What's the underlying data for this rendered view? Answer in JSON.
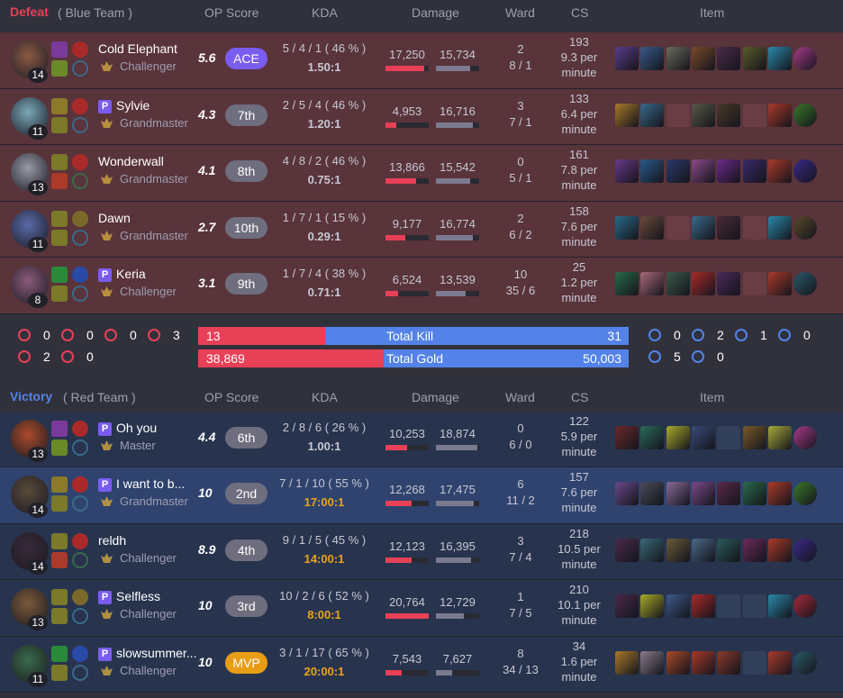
{
  "columns": {
    "op_score": "OP Score",
    "kda": "KDA",
    "damage": "Damage",
    "ward": "Ward",
    "cs": "CS",
    "item": "Item"
  },
  "teams": [
    {
      "result": "Defeat",
      "name": "( Blue Team )",
      "result_color": "#e84057",
      "players": [
        {
          "name": "Cold Elephant",
          "tier": "Challenger",
          "level": "14",
          "score": "5.6",
          "badge": "ACE",
          "kda": "5 / 4 / 1  ( 46 % )",
          "ratio": "1.50:1",
          "dmg_dealt": "17,250",
          "dmg_taken": "15,734",
          "dmg_dealt_fill": 0.9,
          "dmg_taken_fill": 0.8,
          "ward_top": "2",
          "ward_bottom": "8 / 1",
          "cs": "193",
          "cs_rate": "9.3 per",
          "cs_unit": "minute",
          "champ_color": "#8a5a44",
          "items": [
            "#5a3d8a",
            "#3a5a8a",
            "#6a6a5a",
            "#7a4a2a",
            "#4a2a4a",
            "#5a5a2a",
            "#2a8aaa",
            "#aa3a8a"
          ]
        },
        {
          "name": "Sylvie",
          "tier": "Grandmaster",
          "level": "11",
          "score": "4.3",
          "badge": "7th",
          "kda": "2 / 5 / 4  ( 46 % )",
          "ratio": "1.20:1",
          "dmg_dealt": "4,953",
          "dmg_taken": "16,716",
          "dmg_dealt_fill": 0.25,
          "dmg_taken_fill": 0.85,
          "ward_top": "3",
          "ward_bottom": "7 / 1",
          "cs": "133",
          "cs_rate": "6.4 per",
          "cs_unit": "minute",
          "champ_color": "#7aa8b8",
          "items": [
            "#a87a2a",
            "#3a6a8a",
            "",
            "#5a5a4a",
            "#4a3a2a",
            "",
            "#aa3a2a",
            "#3a7a2a"
          ]
        },
        {
          "name": "Wonderwall",
          "tier": "Grandmaster",
          "level": "13",
          "score": "4.1",
          "badge": "8th",
          "kda": "4 / 8 / 2  ( 46 % )",
          "ratio": "0.75:1",
          "dmg_dealt": "13,866",
          "dmg_taken": "15,542",
          "dmg_dealt_fill": 0.7,
          "dmg_taken_fill": 0.8,
          "ward_top": "0",
          "ward_bottom": "5 / 1",
          "cs": "161",
          "cs_rate": "7.8 per",
          "cs_unit": "minute",
          "champ_color": "#9a9aa8",
          "items": [
            "#6a3a8a",
            "#2a5a8a",
            "#2a3a6a",
            "#8a4a8a",
            "#6a2a8a",
            "#3a2a6a",
            "#aa3a2a",
            "#3a2a8a"
          ]
        },
        {
          "name": "Dawn",
          "tier": "Grandmaster",
          "level": "11",
          "score": "2.7",
          "badge": "10th",
          "kda": "1 / 7 / 1  ( 15 % )",
          "ratio": "0.29:1",
          "dmg_dealt": "9,177",
          "dmg_taken": "16,774",
          "dmg_dealt_fill": 0.45,
          "dmg_taken_fill": 0.85,
          "ward_top": "2",
          "ward_bottom": "6 / 2",
          "cs": "158",
          "cs_rate": "7.6 per",
          "cs_unit": "minute",
          "champ_color": "#5a6aa8",
          "items": [
            "#2a6a8a",
            "#6a4a3a",
            "",
            "#3a6a8a",
            "#4a2a3a",
            "",
            "#2a8aaa",
            "#5a4a2a"
          ]
        },
        {
          "name": "Keria",
          "tier": "Challenger",
          "level": "8",
          "score": "3.1",
          "badge": "9th",
          "kda": "1 / 7 / 4  ( 38 % )",
          "ratio": "0.71:1",
          "dmg_dealt": "6,524",
          "dmg_taken": "13,539",
          "dmg_dealt_fill": 0.3,
          "dmg_taken_fill": 0.68,
          "ward_top": "10",
          "ward_bottom": "35 / 6",
          "cs": "25",
          "cs_rate": "1.2 per",
          "cs_unit": "minute",
          "champ_color": "#8a5a7a",
          "items": [
            "#2a6a4a",
            "#aa6a7a",
            "#3a5a4a",
            "#aa2a2a",
            "#4a2a5a",
            "",
            "#aa3a2a",
            "#2a5a6a"
          ]
        }
      ]
    },
    {
      "result": "Victory",
      "name": "( Red Team )",
      "result_color": "#5383e8",
      "players": [
        {
          "name": "Oh you",
          "tier": "Master",
          "level": "13",
          "score": "4.4",
          "badge": "6th",
          "kda": "2 / 8 / 6  ( 26 % )",
          "ratio": "1.00:1",
          "dmg_dealt": "10,253",
          "dmg_taken": "18,874",
          "dmg_dealt_fill": 0.5,
          "dmg_taken_fill": 0.95,
          "ward_top": "0",
          "ward_bottom": "6 / 0",
          "cs": "122",
          "cs_rate": "5.9 per",
          "cs_unit": "minute",
          "champ_color": "#aa4a2a",
          "items": [
            "#6a2a2a",
            "#2a6a5a",
            "#aaaa2a",
            "#3a4a7a",
            "",
            "#7a5a2a",
            "#aaaa3a",
            "#aa3a8a"
          ]
        },
        {
          "name": "I want to b...",
          "tier": "Grandmaster",
          "level": "14",
          "score": "10",
          "badge": "2nd",
          "kda": "7 / 1 / 10  ( 55 % )",
          "ratio": "17:00:1",
          "dmg_dealt": "12,268",
          "dmg_taken": "17,475",
          "dmg_dealt_fill": 0.6,
          "dmg_taken_fill": 0.88,
          "ward_top": "6",
          "ward_bottom": "11 / 2",
          "cs": "157",
          "cs_rate": "7.6 per",
          "cs_unit": "minute",
          "champ_color": "#5a4a3a",
          "items": [
            "#6a4a8a",
            "#4a4a5a",
            "#8a6a9a",
            "#7a4a8a",
            "#5a2a4a",
            "#2a6a4a",
            "#aa3a2a",
            "#3a7a2a"
          ]
        },
        {
          "name": "reldh",
          "tier": "Challenger",
          "level": "14",
          "score": "8.9",
          "badge": "4th",
          "kda": "9 / 1 / 5  ( 45 % )",
          "ratio": "14:00:1",
          "dmg_dealt": "12,123",
          "dmg_taken": "16,395",
          "dmg_dealt_fill": 0.6,
          "dmg_taken_fill": 0.82,
          "ward_top": "3",
          "ward_bottom": "7 / 4",
          "cs": "218",
          "cs_rate": "10.5 per",
          "cs_unit": "minute",
          "champ_color": "#3a2a3a",
          "items": [
            "#4a2a4a",
            "#3a6a7a",
            "#6a5a3a",
            "#4a6a8a",
            "#2a5a5a",
            "#6a2a5a",
            "#aa3a2a",
            "#3a2a8a"
          ]
        },
        {
          "name": "Selfless",
          "tier": "Challenger",
          "level": "13",
          "score": "10",
          "badge": "3rd",
          "kda": "10 / 2 / 6  ( 52 % )",
          "ratio": "8:00:1",
          "dmg_dealt": "20,764",
          "dmg_taken": "12,729",
          "dmg_dealt_fill": 1.0,
          "dmg_taken_fill": 0.64,
          "ward_top": "1",
          "ward_bottom": "7 / 5",
          "cs": "210",
          "cs_rate": "10.1 per",
          "cs_unit": "minute",
          "champ_color": "#7a5a3a",
          "items": [
            "#4a2a4a",
            "#aaaa2a",
            "#3a5a8a",
            "#aa2a2a",
            "",
            "",
            "#2a8aaa",
            "#aa2a3a"
          ]
        },
        {
          "name": "slowsummer...",
          "tier": "Challenger",
          "level": "11",
          "score": "10",
          "badge": "MVP",
          "kda": "3 / 1 / 17  ( 65 % )",
          "ratio": "20:00:1",
          "dmg_dealt": "7,543",
          "dmg_taken": "7,627",
          "dmg_dealt_fill": 0.38,
          "dmg_taken_fill": 0.38,
          "ward_top": "8",
          "ward_bottom": "34 / 13",
          "cs": "34",
          "cs_rate": "1.6 per",
          "cs_unit": "minute",
          "champ_color": "#3a6a4a",
          "items": [
            "#aa7a2a",
            "#8a7a8a",
            "#aa4a2a",
            "#aa3a2a",
            "#8a3a2a",
            "",
            "#aa3a2a",
            "#2a5a6a"
          ]
        }
      ]
    }
  ],
  "summary": {
    "kill_label": "Total Kill",
    "kill_left": "13",
    "kill_right": "31",
    "kill_fill": 0.295,
    "gold_label": "Total Gold",
    "gold_left": "38,869",
    "gold_right": "50,003",
    "gold_fill": 0.43,
    "left_obj_row1": [
      "0",
      "0",
      "0",
      "3"
    ],
    "left_obj_row2": [
      "2",
      "0"
    ],
    "right_obj_row1": [
      "0",
      "2",
      "1",
      "0"
    ],
    "right_obj_row2": [
      "5",
      "0"
    ]
  }
}
